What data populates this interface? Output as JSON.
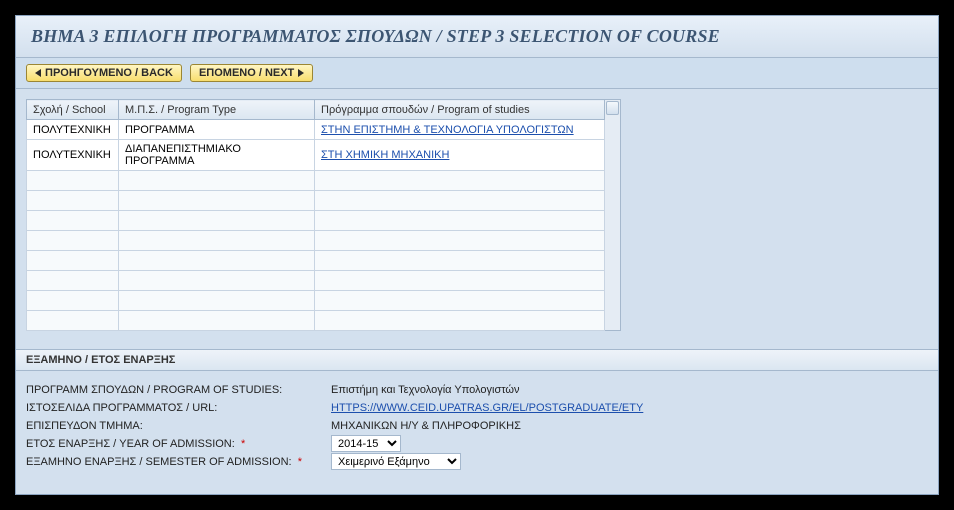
{
  "title": "ΒΗΜΑ 3 ΕΠΙΛΟΓΗ ΠΡΟΓΡΑΜΜΑΤΟΣ ΣΠΟΥΔΩΝ / STEP 3 SELECTION OF COURSE",
  "toolbar": {
    "back": "ΠΡΟΗΓΟΥΜΕΝΟ / BACK",
    "next": "ΕΠΟΜΕΝΟ / NEXT"
  },
  "grid": {
    "headers": {
      "school": "Σχολή / School",
      "type": "Μ.Π.Σ. / Program Type",
      "program": "Πρόγραμμα σπουδών / Program of studies"
    },
    "rows": [
      {
        "school": "ΠΟΛΥΤΕΧΝΙΚΗ",
        "type": "ΠΡΟΓΡΑΜΜΑ",
        "program": "ΣΤΗΝ ΕΠΙΣΤΗΜΗ & ΤΕΧΝΟΛΟΓΙΑ ΥΠΟΛΟΓΙΣΤΩΝ"
      },
      {
        "school": "ΠΟΛΥΤΕΧΝΙΚΗ",
        "type": "ΔΙΑΠΑΝΕΠΙΣΤΗΜΙΑΚΟ ΠΡΟΓΡΑΜΜΑ",
        "program": "ΣΤΗ ΧΗΜΙΚΗ ΜΗΧΑΝΙΚΗ"
      }
    ],
    "empty_rows": 8
  },
  "section": {
    "header": "ΕΞΑΜΗΝΟ / ΕΤΟΣ ΕΝΑΡΞΗΣ",
    "labels": {
      "program_of_studies": "ΠΡΟΓΡΑΜΜ ΣΠΟΥΔΩΝ / PROGRAM OF STUDIES:",
      "url": "ΙΣΤΟΣΕΛΙΔΑ ΠΡΟΓΡΑΜΜΑΤΟΣ / URL:",
      "supervising_dept": "ΕΠΙΣΠΕΥΔΟΝ ΤΜΗΜΑ:",
      "year_of_admission": "ΕΤΟΣ ΕΝΑΡΞΗΣ / YEAR OF ADMISSION:",
      "semester_of_admission": "ΕΞΑΜΗΝΟ ΕΝΑΡΞΗΣ / SEMESTER OF ADMISSION:"
    },
    "values": {
      "program_of_studies": "Επιστήμη και Τεχνολογία Υπολογιστών",
      "url": "HTTPS://WWW.CEID.UPATRAS.GR/EL/POSTGRADUATE/ETY",
      "supervising_dept": "ΜΗΧΑΝΙΚΩΝ Η/Υ & ΠΛΗΡΟΦΟΡΙΚΗΣ",
      "year_selected": "2014-15",
      "semester_selected": "Χειμερινό Εξάμηνο"
    },
    "required_marker": "*"
  }
}
